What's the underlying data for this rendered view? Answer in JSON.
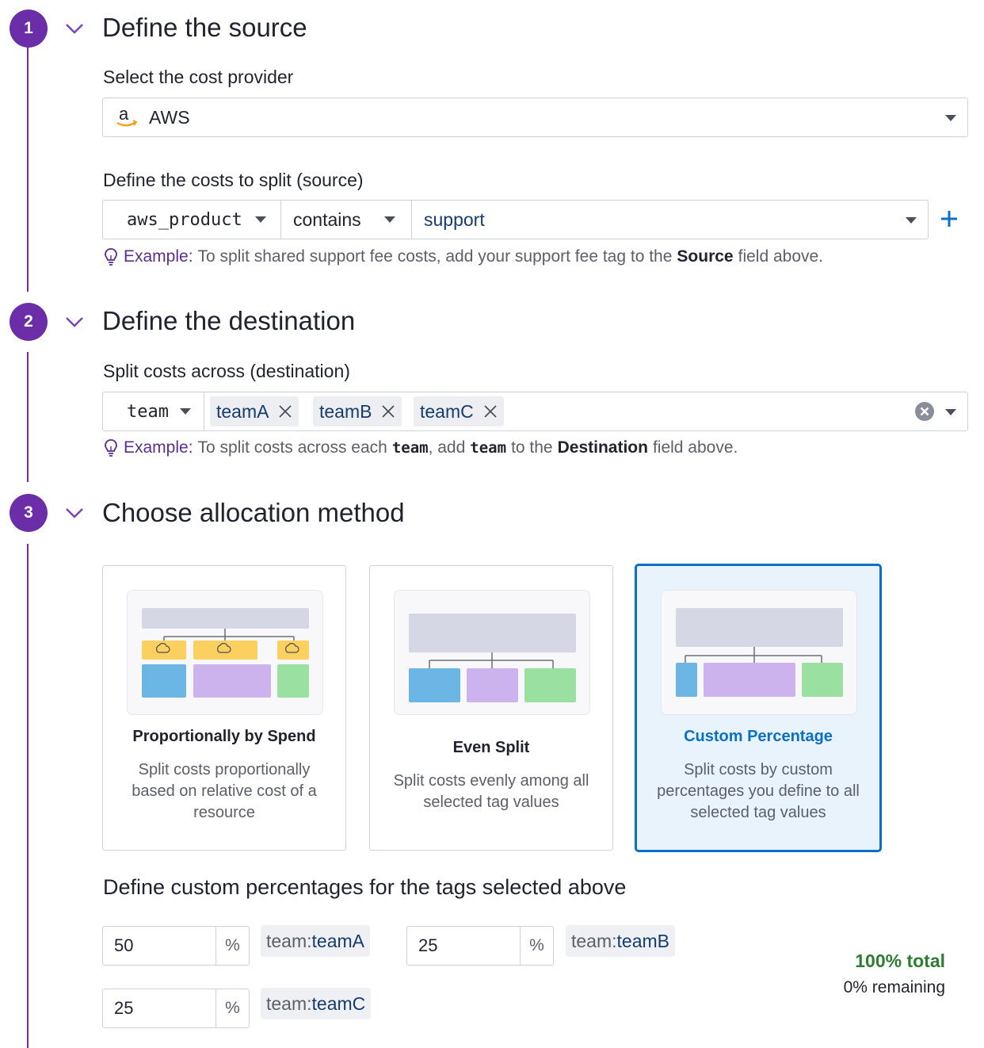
{
  "steps": [
    {
      "number": "1",
      "title": "Define the source"
    },
    {
      "number": "2",
      "title": "Define the destination"
    },
    {
      "number": "3",
      "title": "Choose allocation method"
    }
  ],
  "source": {
    "provider_label": "Select the cost provider",
    "provider_icon": "amazon-logo-icon",
    "provider_value": "AWS",
    "costs_label": "Define the costs to split (source)",
    "filter_key": "aws_product",
    "filter_operator": "contains",
    "filter_value": "support",
    "hint_prefix": "Example:",
    "hint_text_1": "To split shared support fee costs, add your support fee tag to the",
    "hint_bold": "Source",
    "hint_text_2": "field above."
  },
  "destination": {
    "label": "Split costs across (destination)",
    "tag_key": "team",
    "tag_values": [
      "teamA",
      "teamB",
      "teamC"
    ],
    "hint_prefix": "Example:",
    "hint_text_1": "To split costs across each",
    "hint_code_1": "team",
    "hint_text_2": ", add",
    "hint_code_2": "team",
    "hint_text_3": "to the",
    "hint_bold": "Destination",
    "hint_text_4": "field above."
  },
  "methods": [
    {
      "title": "Proportionally by Spend",
      "description": "Split costs proportionally based on relative cost of a resource",
      "selected": false
    },
    {
      "title": "Even Split",
      "description": "Split costs evenly among all selected tag values",
      "selected": false
    },
    {
      "title": "Custom Percentage",
      "description": "Split costs by custom percentages you define to all selected tag values",
      "selected": true
    }
  ],
  "custom": {
    "heading": "Define custom percentages for the tags selected above",
    "unit": "%",
    "rows": [
      {
        "value": "50",
        "tag_key": "team:",
        "tag_value": "teamA"
      },
      {
        "value": "25",
        "tag_key": "team:",
        "tag_value": "teamB"
      },
      {
        "value": "25",
        "tag_key": "team:",
        "tag_value": "teamC"
      }
    ],
    "total": "100% total",
    "remaining": "0% remaining"
  },
  "colors": {
    "step": "#6c2ea8",
    "accent": "#0a6fc7",
    "total_ok": "#2e7d32",
    "bar_blue": "#6cb6e6",
    "bar_purple": "#ccb3ee",
    "bar_green": "#99e0a1",
    "bar_yellow": "#fcd05e",
    "bar_grey": "#d5d7e4"
  }
}
